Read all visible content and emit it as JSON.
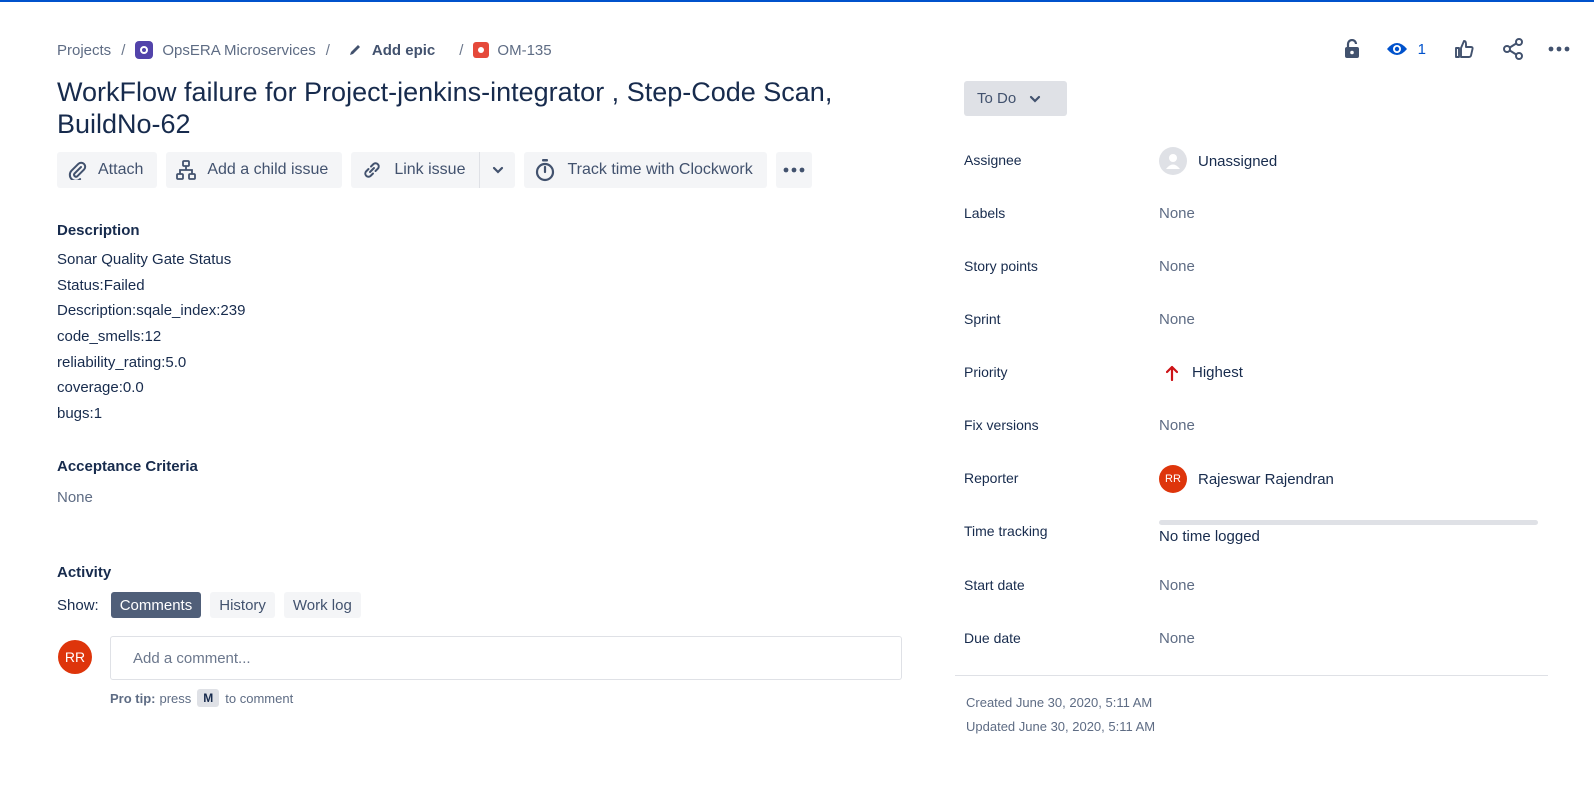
{
  "breadcrumb": {
    "projects": "Projects",
    "project": "OpsERA Microservices",
    "epic": "Add epic",
    "issue_key": "OM-135"
  },
  "top_actions": {
    "watchers_count": "1"
  },
  "issue": {
    "title": "WorkFlow failure for Project-jenkins-integrator , Step-Code Scan, BuildNo-62"
  },
  "toolbar": {
    "attach": "Attach",
    "add_child": "Add a child issue",
    "link_issue": "Link issue",
    "clockwork": "Track time with Clockwork"
  },
  "description": {
    "heading": "Description",
    "lines": [
      "Sonar Quality Gate Status",
      "Status:Failed",
      "Description:sqale_index:239",
      "code_smells:12",
      "reliability_rating:5.0",
      "coverage:0.0",
      "bugs:1"
    ]
  },
  "acceptance": {
    "heading": "Acceptance Criteria",
    "value": "None"
  },
  "activity": {
    "heading": "Activity",
    "show_label": "Show:",
    "filters": [
      "Comments",
      "History",
      "Work log"
    ],
    "active_filter": "Comments",
    "avatar_initials": "RR",
    "comment_placeholder": "Add a comment...",
    "protip_label": "Pro tip:",
    "protip_press": "press",
    "protip_key": "M",
    "protip_suffix": "to comment"
  },
  "status": {
    "label": "To Do"
  },
  "fields": {
    "assignee": {
      "label": "Assignee",
      "value": "Unassigned"
    },
    "labels": {
      "label": "Labels",
      "value": "None"
    },
    "story_points": {
      "label": "Story points",
      "value": "None"
    },
    "sprint": {
      "label": "Sprint",
      "value": "None"
    },
    "priority": {
      "label": "Priority",
      "value": "Highest",
      "color": "#cd1317"
    },
    "fix_versions": {
      "label": "Fix versions",
      "value": "None"
    },
    "reporter": {
      "label": "Reporter",
      "value": "Rajeswar Rajendran",
      "initials": "RR"
    },
    "time_tracking": {
      "label": "Time tracking",
      "value": "No time logged"
    },
    "start_date": {
      "label": "Start date",
      "value": "None"
    },
    "due_date": {
      "label": "Due date",
      "value": "None"
    }
  },
  "meta": {
    "created": "Created June 30, 2020, 5:11 AM",
    "updated": "Updated June 30, 2020, 5:11 AM"
  },
  "colors": {
    "brand": "#0052cc",
    "avatar": "#de350b",
    "active_filter_bg": "#505f79"
  },
  "icons": [
    "pencil-icon",
    "lock-open-icon",
    "eye-icon",
    "thumbs-up-icon",
    "share-icon",
    "more-icon",
    "paperclip-icon",
    "hierarchy-icon",
    "link-icon",
    "chevron-down-icon",
    "stopwatch-icon",
    "arrow-up-icon",
    "user-icon"
  ]
}
